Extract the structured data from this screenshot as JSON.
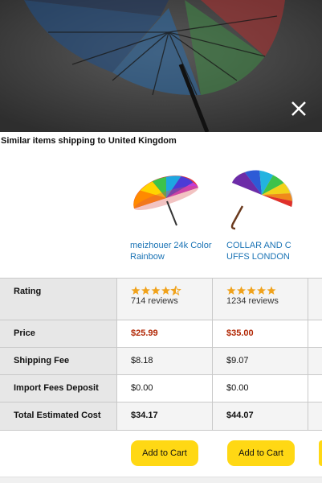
{
  "section": {
    "title": "Similar items shipping to United Kingdom"
  },
  "products": [
    {
      "name": "meizhouer 24k Color Rainbow",
      "rating_stars": 4.5,
      "reviews": "714 reviews",
      "price": "$25.99",
      "shipping_fee": "$8.18",
      "import_fees": "$0.00",
      "total": "$34.17",
      "cart_label": "Add to Cart"
    },
    {
      "name": "COLLAR AND C UFFS LONDON",
      "rating_stars": 5,
      "reviews": "1234 reviews",
      "price": "$35.00",
      "shipping_fee": "$9.07",
      "import_fees": "$0.00",
      "total": "$44.07",
      "cart_label": "Add to Cart"
    }
  ],
  "table": {
    "labels": {
      "rating": "Rating",
      "price": "Price",
      "shipping": "Shipping Fee",
      "import": "Import Fees Deposit",
      "total": "Total Estimated Cost"
    }
  },
  "colors": {
    "price": "#b12704",
    "link": "#1a73b5",
    "cart_button": "#ffd814",
    "star": "#f0a21b"
  },
  "icons": {
    "close": "close-icon",
    "star": "star-icon"
  }
}
